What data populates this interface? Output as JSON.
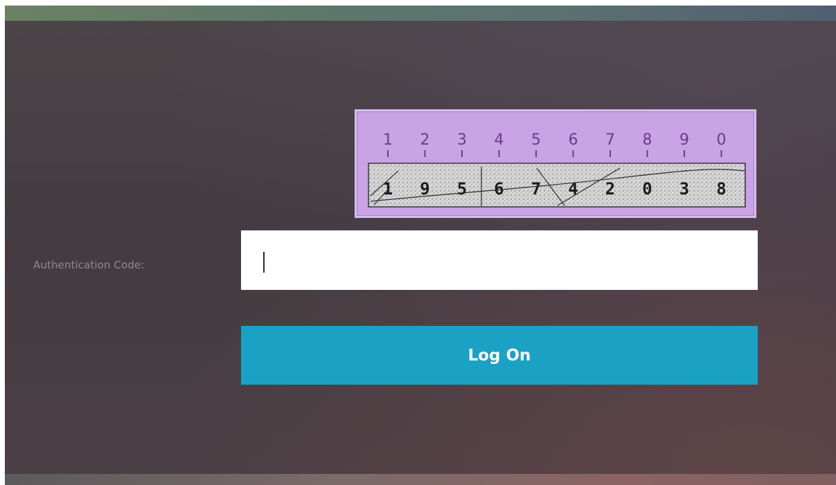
{
  "login": {
    "auth_label": "Authentication Code:",
    "input_value": "",
    "button_label": "Log On"
  },
  "captcha": {
    "positions": [
      "1",
      "2",
      "3",
      "4",
      "5",
      "6",
      "7",
      "8",
      "9",
      "0"
    ],
    "digits": [
      "1",
      "9",
      "5",
      "6",
      "7",
      "4",
      "2",
      "0",
      "3",
      "8"
    ]
  },
  "colors": {
    "button": "#1aa1c3",
    "captcha_panel": "#c9a3e5",
    "position_digits": "#6a3c8a"
  }
}
